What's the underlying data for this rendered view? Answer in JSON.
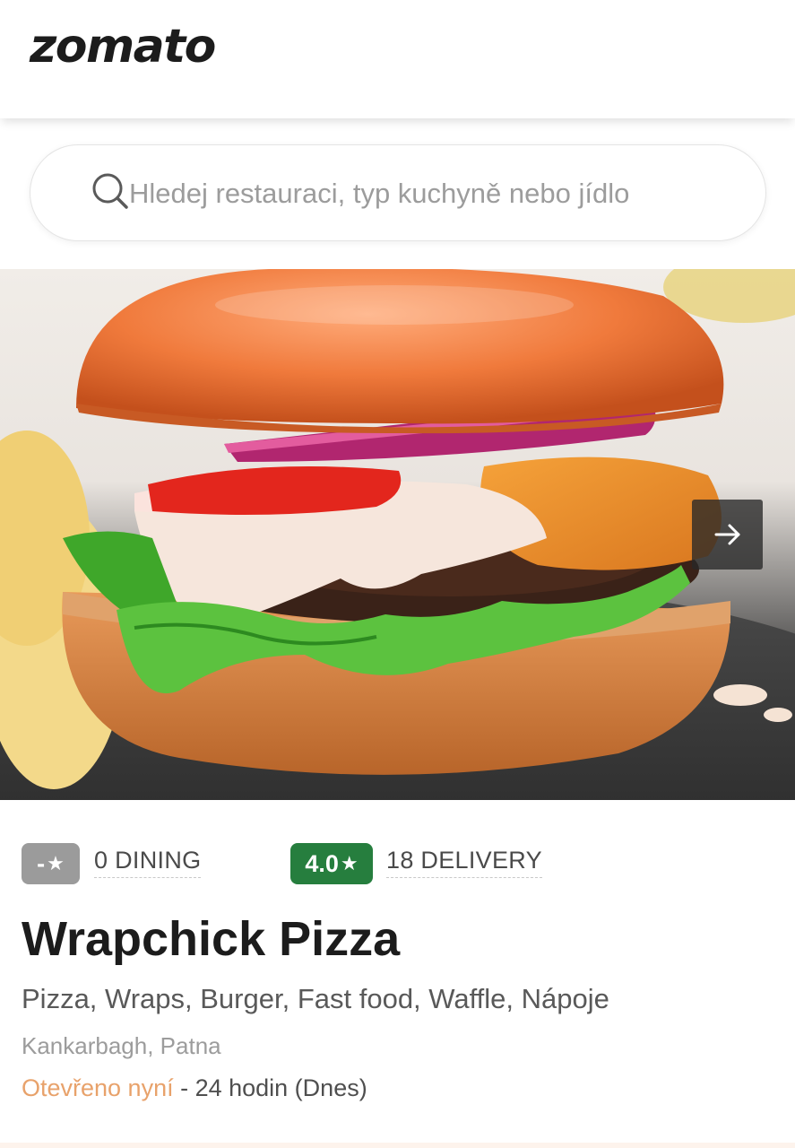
{
  "header": {
    "logo_text": "zomato"
  },
  "search": {
    "placeholder": "Hledej restauraci, typ kuchyně nebo jídlo",
    "value": ""
  },
  "hero": {
    "image_alt": "cheeseburger photo",
    "next_icon": "arrow-right-icon"
  },
  "ratings": {
    "dining": {
      "badge": "-",
      "count_label": "0 DINING",
      "color": "#9b9b9b"
    },
    "delivery": {
      "badge": "4.0",
      "count_label": "18 DELIVERY",
      "color": "#267e3e"
    },
    "star_icon": "star-icon"
  },
  "restaurant": {
    "name": "Wrapchick Pizza",
    "cuisines": "Pizza, Wraps, Burger, Fast food, Waffle, Nápoje",
    "location": "Kankarbagh, Patna",
    "status": "Otevřeno nyní",
    "hours": " - 24 hodin (Dnes)",
    "status_color": "#e8a26b"
  }
}
